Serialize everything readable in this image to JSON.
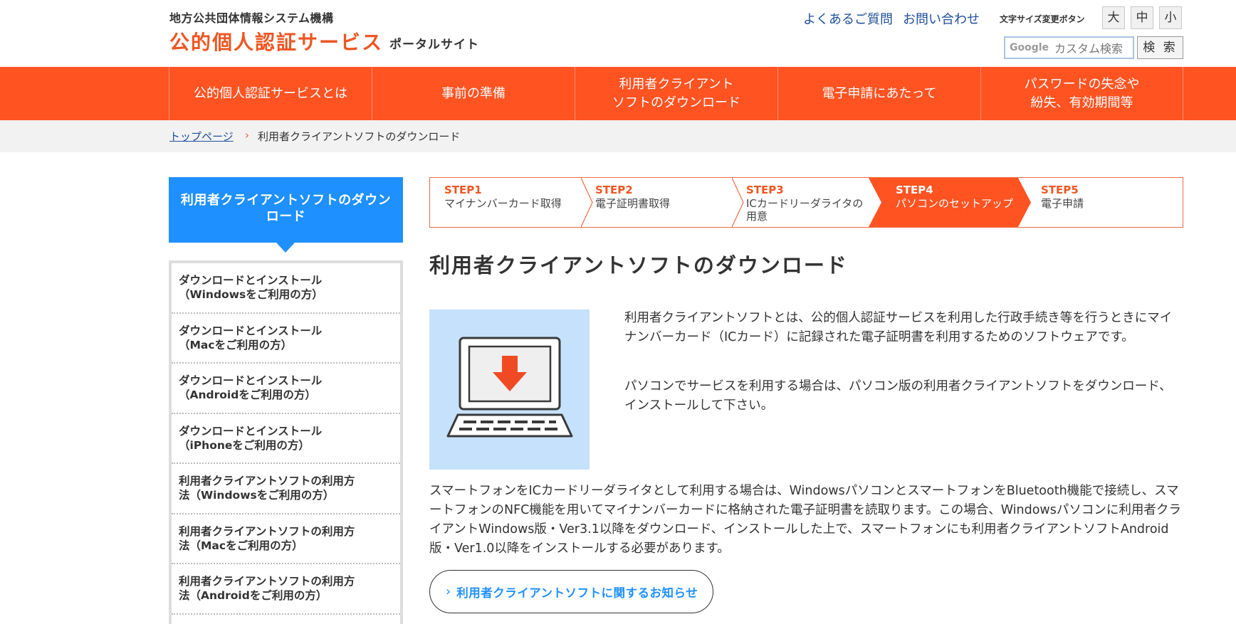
{
  "header": {
    "org_name": "地方公共団体情報システム機構",
    "service_name": "公的個人認証サービス",
    "portal_label": "ポータルサイト",
    "faq_link": "よくあるご質問",
    "contact_link": "お問い合わせ",
    "font_size_label": "文字サイズ変更ボタン",
    "font_large": "大",
    "font_medium": "中",
    "font_small": "小",
    "search_logo": "Google",
    "search_placeholder": "カスタム検索",
    "search_button": "検 索"
  },
  "nav": {
    "items": [
      {
        "label": "公的個人認証サービスとは"
      },
      {
        "label": "事前の準備"
      },
      {
        "label": "利用者クライアント\nソフトのダウンロード"
      },
      {
        "label": "電子申請にあたって"
      },
      {
        "label": "パスワードの失念や\n紛失、有効期間等"
      }
    ]
  },
  "breadcrumb": {
    "home": "トップページ",
    "separator": "›",
    "current": "利用者クライアントソフトのダウンロード"
  },
  "sidebar": {
    "heading": "利用者クライアントソフトのダウン\nロード",
    "items": [
      {
        "label": "ダウンロードとインストール\n（Windowsをご利用の方）"
      },
      {
        "label": "ダウンロードとインストール\n（Macをご利用の方）"
      },
      {
        "label": "ダウンロードとインストール\n（Androidをご利用の方）"
      },
      {
        "label": "ダウンロードとインストール\n（iPhoneをご利用の方）"
      },
      {
        "label": "利用者クライアントソフトの利用方\n法（Windowsをご利用の方）"
      },
      {
        "label": "利用者クライアントソフトの利用方\n法（Macをご利用の方）"
      },
      {
        "label": "利用者クライアントソフトの利用方\n法（Androidをご利用の方）"
      }
    ]
  },
  "steps": [
    {
      "num": "STEP1",
      "label": "マイナンバーカード取得",
      "active": false
    },
    {
      "num": "STEP2",
      "label": "電子証明書取得",
      "active": false
    },
    {
      "num": "STEP3",
      "label": "ICカードリーダライタの\n用意",
      "active": false
    },
    {
      "num": "STEP4",
      "label": "パソコンのセットアップ",
      "active": true
    },
    {
      "num": "STEP5",
      "label": "電子申請",
      "active": false
    }
  ],
  "main": {
    "title": "利用者クライアントソフトのダウンロード",
    "paragraph1": "利用者クライアントソフトとは、公的個人認証サービスを利用した行政手続き等を行うときにマイナンバーカード（ICカード）に記録された電子証明書を利用するためのソフトウェアです。",
    "paragraph2": "パソコンでサービスを利用する場合は、パソコン版の利用者クライアントソフトをダウンロード、インストールして下さい。",
    "paragraph3": "スマートフォンをICカードリーダライタとして利用する場合は、WindowsパソコンとスマートフォンをBluetooth機能で接続し、スマートフォンのNFC機能を用いてマイナンバーカードに格納された電子証明書を読取ります。この場合、Windowsパソコンに利用者クライアントWindows版・Ver3.1以降をダウンロード、インストールした上で、スマートフォンにも利用者クライアントソフトAndroid版・Ver1.0以降をインストールする必要があります。",
    "notice_button": "利用者クライアントソフトに関するお知らせ"
  },
  "colors": {
    "brand_orange": "#ff5322",
    "link_blue": "#1f4e9a",
    "sidebar_blue": "#1e90ff",
    "illustration_bg": "#c6e1fb"
  },
  "icons": {
    "illustration": "laptop-download-icon",
    "notice_arrow": "chevron-right-icon",
    "breadcrumb_separator": "chevron-right-icon"
  }
}
